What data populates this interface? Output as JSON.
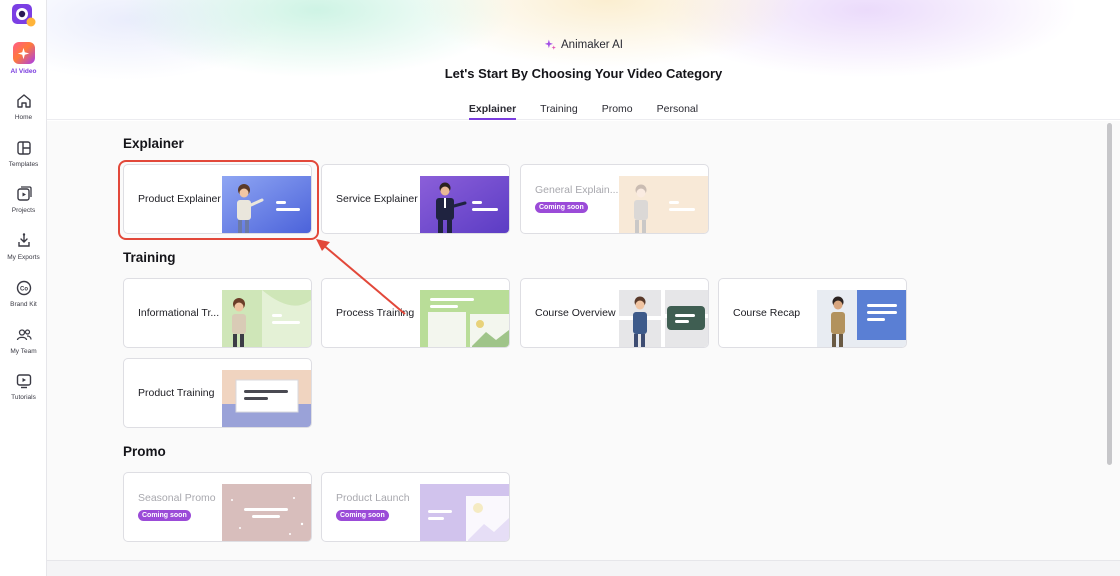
{
  "app": {
    "brand_name": "Animaker AI",
    "accent": "#7a3cdf"
  },
  "sidebar": {
    "items": [
      {
        "label": "AI Video",
        "icon": "ai-video-icon",
        "active": true
      },
      {
        "label": "Home",
        "icon": "home-icon"
      },
      {
        "label": "Templates",
        "icon": "templates-icon"
      },
      {
        "label": "Projects",
        "icon": "projects-icon"
      },
      {
        "label": "My Exports",
        "icon": "exports-icon"
      },
      {
        "label": "Brand Kit",
        "icon": "brand-kit-icon"
      },
      {
        "label": "My Team",
        "icon": "team-icon"
      },
      {
        "label": "Tutorials",
        "icon": "tutorials-icon"
      }
    ]
  },
  "header": {
    "title": "Let's Start By Choosing Your Video Category",
    "tabs": [
      "Explainer",
      "Training",
      "Promo",
      "Personal"
    ],
    "active_tab": "Explainer"
  },
  "sections": [
    {
      "title": "Explainer",
      "cards": [
        {
          "label": "Product Explainer"
        },
        {
          "label": "Service Explainer"
        },
        {
          "label": "General Explain...",
          "badge": "Coming soon"
        }
      ]
    },
    {
      "title": "Training",
      "cards": [
        {
          "label": "Informational Tr..."
        },
        {
          "label": "Process Training"
        },
        {
          "label": "Course Overview"
        },
        {
          "label": "Course Recap"
        },
        {
          "label": "Product Training"
        }
      ]
    },
    {
      "title": "Promo",
      "cards": [
        {
          "label": "Seasonal Promo",
          "badge": "Coming soon"
        },
        {
          "label": "Product Launch",
          "badge": "Coming soon"
        }
      ]
    }
  ],
  "annotation": {
    "highlight_color": "#e2483a"
  }
}
